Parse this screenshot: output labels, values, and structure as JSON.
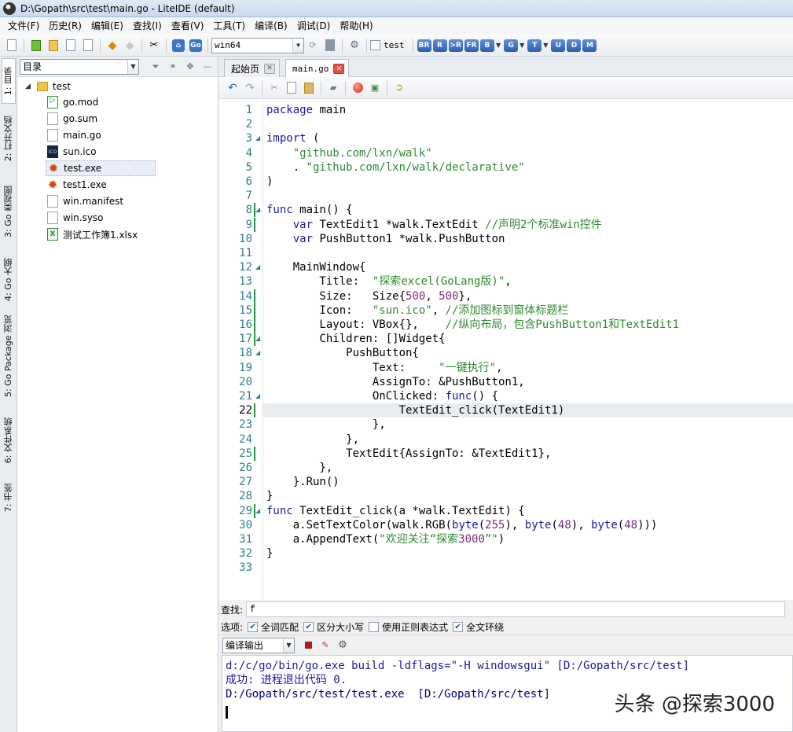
{
  "window": {
    "title": "D:\\Gopath\\src\\test\\main.go - LiteIDE (default)"
  },
  "menu": [
    "文件(F)",
    "历史(R)",
    "编辑(E)",
    "查找(I)",
    "查看(V)",
    "工具(T)",
    "编译(B)",
    "调试(D)",
    "帮助(H)"
  ],
  "toolbar": {
    "env_select": "win64",
    "test_label": "test",
    "build_tags": [
      "BR",
      "R",
      ">R",
      "FR",
      "B",
      "G",
      "T",
      "U",
      "D",
      "M"
    ]
  },
  "sidebar_tabs": [
    "1: 目录",
    "2: 打开文档",
    "3: Go 类视图",
    "4: Go 大纲",
    "5: Go Package 浏览",
    "6: 文件系统",
    "7: 书签"
  ],
  "filetree": {
    "view_select": "目录",
    "root": "test",
    "items": [
      {
        "name": "go.mod",
        "icon": "go-mod-file-icon"
      },
      {
        "name": "go.sum",
        "icon": "file-icon"
      },
      {
        "name": "main.go",
        "icon": "file-icon"
      },
      {
        "name": "sun.ico",
        "icon": "ico-file-icon"
      },
      {
        "name": "test.exe",
        "icon": "exe-gear-icon"
      },
      {
        "name": "test1.exe",
        "icon": "exe-gear-icon"
      },
      {
        "name": "win.manifest",
        "icon": "file-icon"
      },
      {
        "name": "win.syso",
        "icon": "file-icon"
      },
      {
        "name": "测试工作簿1.xlsx",
        "icon": "excel-file-icon"
      }
    ],
    "selected": "test.exe"
  },
  "editor": {
    "tabs": [
      "起始页",
      "main.go"
    ],
    "active_tab": "main.go",
    "current_line": 22,
    "lines": [
      "package main",
      "",
      "import (",
      "    \"github.com/lxn/walk\"",
      "    . \"github.com/lxn/walk/declarative\"",
      ")",
      "",
      "func main() {",
      "    var TextEdit1 *walk.TextEdit //声明2个标准win控件",
      "    var PushButton1 *walk.PushButton",
      "",
      "    MainWindow{",
      "        Title:  \"探索excel(GoLang版)\",",
      "        Size:   Size{500, 500},",
      "        Icon:   \"sun.ico\", //添加图标到窗体标题栏",
      "        Layout: VBox{},    //纵向布局，包含PushButton1和TextEdit1",
      "        Children: []Widget{",
      "            PushButton{",
      "                Text:     \"一键执行\",",
      "                AssignTo: &PushButton1,",
      "                OnClicked: func() {",
      "                    TextEdit_click(TextEdit1)",
      "                },",
      "            },",
      "            TextEdit{AssignTo: &TextEdit1},",
      "        },",
      "    }.Run()",
      "}",
      "func TextEdit_click(a *walk.TextEdit) {",
      "    a.SetTextColor(walk.RGB(byte(255), byte(48), byte(48)))",
      "    a.AppendText(\"欢迎关注“探索3000”\")",
      "}",
      ""
    ]
  },
  "find": {
    "label": "查找:",
    "value": "f",
    "options_label": "选项:",
    "options": [
      {
        "label": "全词匹配",
        "checked": true
      },
      {
        "label": "区分大小写",
        "checked": true
      },
      {
        "label": "使用正则表达式",
        "checked": false
      },
      {
        "label": "全文环绕",
        "checked": true
      }
    ]
  },
  "output": {
    "select": "编译输出",
    "lines": [
      {
        "text": "d:/c/go/bin/go.exe build -ldflags=\"-H windowsgui\" [D:/Gopath/src/test]",
        "color": "#1a1a9c"
      },
      {
        "text": "成功: 进程退出代码 0.",
        "color": "#1a1a9c"
      },
      {
        "text": "D:/Gopath/src/test/test.exe  [D:/Gopath/src/test]",
        "color": "#000080"
      }
    ]
  },
  "watermark": "头条 @探索3000"
}
